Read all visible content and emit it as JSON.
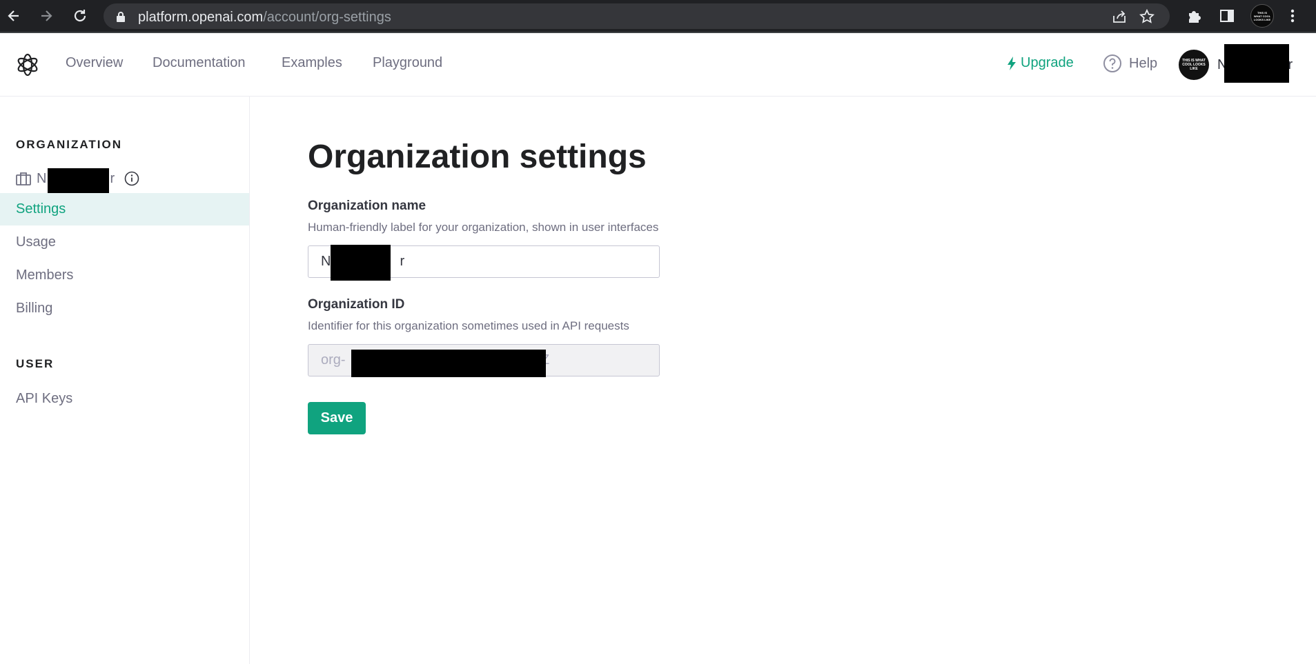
{
  "browser": {
    "url_host": "platform.openai.com",
    "url_path": "/account/org-settings",
    "profile_badge": "THIS IS WHAT COOL LOOKS LIKE"
  },
  "header": {
    "nav": [
      "Overview",
      "Documentation",
      "Examples",
      "Playground"
    ],
    "upgrade_label": "Upgrade",
    "help_label": "Help",
    "user_name_start": "N",
    "user_name_end": "r",
    "avatar_text": "THIS IS WHAT COOL LOOKS LIKE"
  },
  "sidebar": {
    "org_section_title": "ORGANIZATION",
    "org_name_start": "N",
    "org_name_end": "r",
    "org_items": [
      "Settings",
      "Usage",
      "Members",
      "Billing"
    ],
    "active_item": "Settings",
    "user_section_title": "USER",
    "user_items": [
      "API Keys"
    ]
  },
  "main": {
    "title": "Organization settings",
    "org_name_label": "Organization name",
    "org_name_desc": "Human-friendly label for your organization, shown in user interfaces",
    "org_name_value": "N                  r",
    "org_id_label": "Organization ID",
    "org_id_desc": "Identifier for this organization sometimes used in API requests",
    "org_id_value": "org-                                                   Z",
    "save_label": "Save"
  },
  "colors": {
    "accent": "#10a37f",
    "active_bg": "#e6f3f3",
    "chrome_bg": "#202124"
  }
}
